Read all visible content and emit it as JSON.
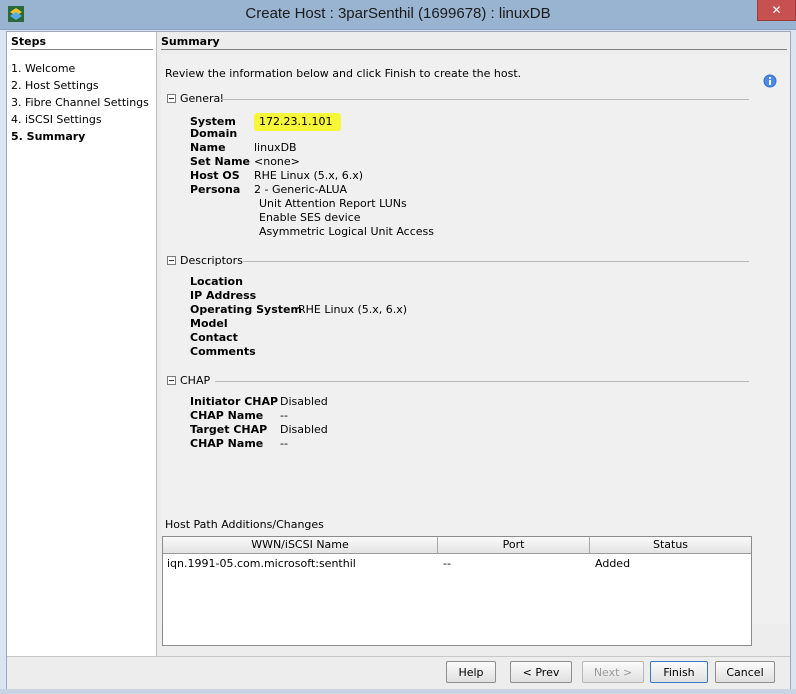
{
  "window": {
    "title": "Create Host : 3parSenthil (1699678) : linuxDB",
    "close_glyph": "✕"
  },
  "steps": {
    "title": "Steps",
    "items": [
      {
        "label": "1. Welcome"
      },
      {
        "label": "2. Host Settings"
      },
      {
        "label": "3. Fibre Channel Settings"
      },
      {
        "label": "4. iSCSI Settings"
      },
      {
        "label": "5. Summary"
      }
    ]
  },
  "summary": {
    "header": "Summary",
    "intro": "Review the information below and click Finish to create the host.",
    "info_icon": "info-icon"
  },
  "general": {
    "title": "General",
    "fields": [
      {
        "label": "System",
        "value": "172.23.1.101"
      },
      {
        "label": "Domain",
        "value": ""
      },
      {
        "label": "Name",
        "value": "linuxDB"
      },
      {
        "label": "Set Name",
        "value": "<none>"
      },
      {
        "label": "Host OS",
        "value": "RHE Linux (5.x, 6.x)"
      },
      {
        "label": "Persona",
        "value": "2 - Generic-ALUA"
      }
    ],
    "persona_extra": [
      "Unit Attention Report LUNs",
      "Enable SES device",
      "Asymmetric Logical Unit Access"
    ]
  },
  "descriptors": {
    "title": "Descriptors",
    "fields": [
      {
        "label": "Location",
        "value": ""
      },
      {
        "label": "IP Address",
        "value": ""
      },
      {
        "label": "Operating System",
        "value": "RHE Linux (5.x, 6.x)"
      },
      {
        "label": "Model",
        "value": ""
      },
      {
        "label": "Contact",
        "value": ""
      },
      {
        "label": "Comments",
        "value": ""
      }
    ]
  },
  "chap": {
    "title": "CHAP",
    "fields": [
      {
        "label": "Initiator CHAP",
        "value": "Disabled"
      },
      {
        "label": "CHAP Name",
        "value": "--"
      },
      {
        "label": "Target CHAP",
        "value": "Disabled"
      },
      {
        "label": "CHAP Name",
        "value": "--"
      }
    ]
  },
  "paths": {
    "label": "Host Path Additions/Changes",
    "columns": [
      "WWN/iSCSI Name",
      "Port",
      "Status"
    ],
    "rows": [
      {
        "name": "iqn.1991-05.com.microsoft:senthil",
        "port": "--",
        "status": "Added"
      }
    ]
  },
  "buttons": {
    "help": "Help",
    "prev": "< Prev",
    "next": "Next >",
    "finish": "Finish",
    "cancel": "Cancel"
  },
  "colors": {
    "highlight": "#f7f73a",
    "titlebar": "#99b4d1",
    "close": "#c75050"
  }
}
